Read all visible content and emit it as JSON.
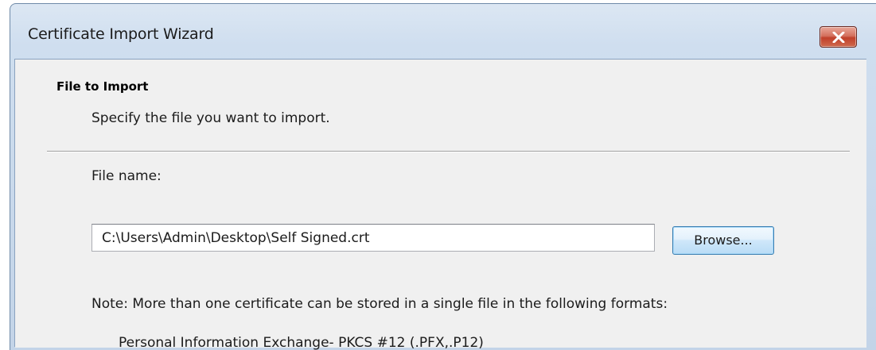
{
  "window": {
    "title": "Certificate Import Wizard",
    "close_icon": "close-icon"
  },
  "header": {
    "title": "File to Import",
    "subtitle": "Specify the file you want to import."
  },
  "form": {
    "file_name_label": "File name:",
    "file_name_value": "C:\\Users\\Admin\\Desktop\\Self Signed.crt",
    "browse_label": "Browse..."
  },
  "note": {
    "text": "Note:  More than one certificate can be stored in a single file in the following formats:",
    "formats": [
      "Personal Information Exchange- PKCS #12 (.PFX,.P12)"
    ]
  },
  "colors": {
    "close_button": "#c7432c",
    "browse_border": "#3c7fb1",
    "client_background": "#f0f0f0"
  }
}
